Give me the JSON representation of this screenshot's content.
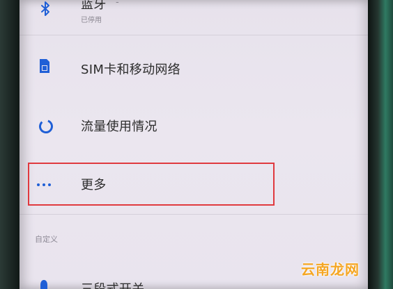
{
  "bluetooth": {
    "title": "蓝牙",
    "status": "已停用",
    "trailing": "-"
  },
  "sim": {
    "title": "SIM卡和移动网络"
  },
  "data_usage": {
    "title": "流量使用情况"
  },
  "more": {
    "title": "更多"
  },
  "custom_section": {
    "header": "自定义"
  },
  "alert_slider": {
    "title": "三段式开关"
  },
  "watermark": {
    "text": "云南龙网"
  },
  "colors": {
    "accent_icon": "#1f5fd6",
    "highlight_box": "#e0393e",
    "watermark": "#f5a623",
    "screen_bg": "#e9e4ee"
  }
}
